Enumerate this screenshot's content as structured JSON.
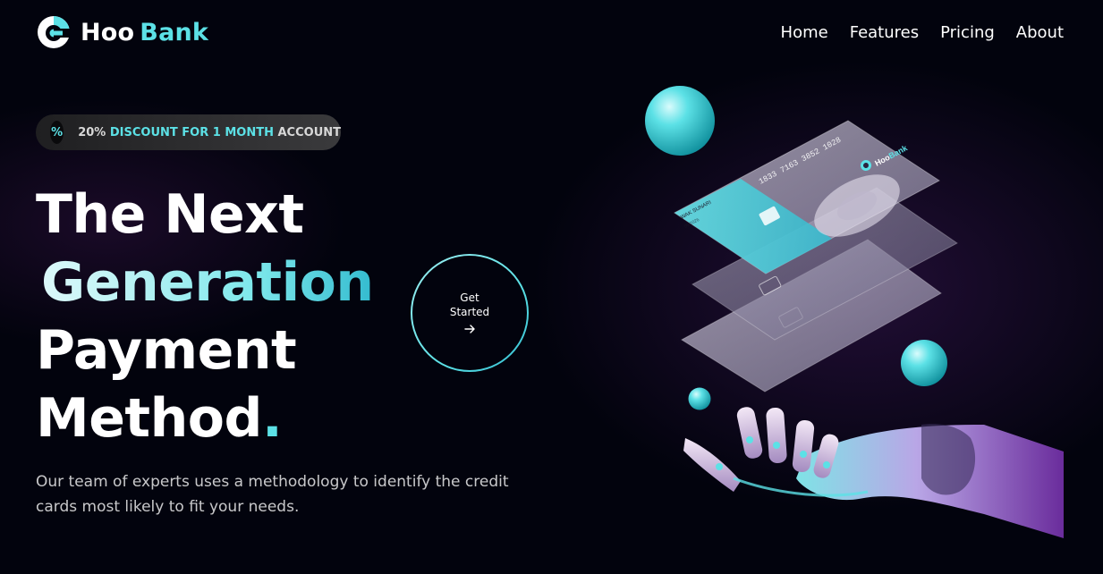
{
  "brand": {
    "name_part1": "Hoo",
    "name_part2": "Bank",
    "accent": "#5ce1e6",
    "background": "#00040f"
  },
  "nav": {
    "items": [
      {
        "label": "Home"
      },
      {
        "label": "Features"
      },
      {
        "label": "Pricing"
      },
      {
        "label": "About"
      }
    ]
  },
  "promo": {
    "icon": "percent-icon",
    "icon_glyph": "%",
    "text_part1": "20%",
    "text_part2": "DISCOUNT",
    "text_part3": "FOR",
    "text_part4": "1 MONTH",
    "text_part5": "ACCOUNT"
  },
  "hero": {
    "line1": "The Next",
    "line2": "Generation",
    "line3": "Payment",
    "line4": "Method",
    "line4_dot": ".",
    "description": "Our team of experts uses a methodology to identify the credit cards most likely to fit your needs.",
    "cta_line1": "Get",
    "cta_line2": "Started",
    "card_number": "1833 7163 3852 1028",
    "card_holder": "WAK SUNARI",
    "card_date": "09/2026",
    "card_brand_part1": "Hoo",
    "card_brand_part2": "Bank"
  }
}
